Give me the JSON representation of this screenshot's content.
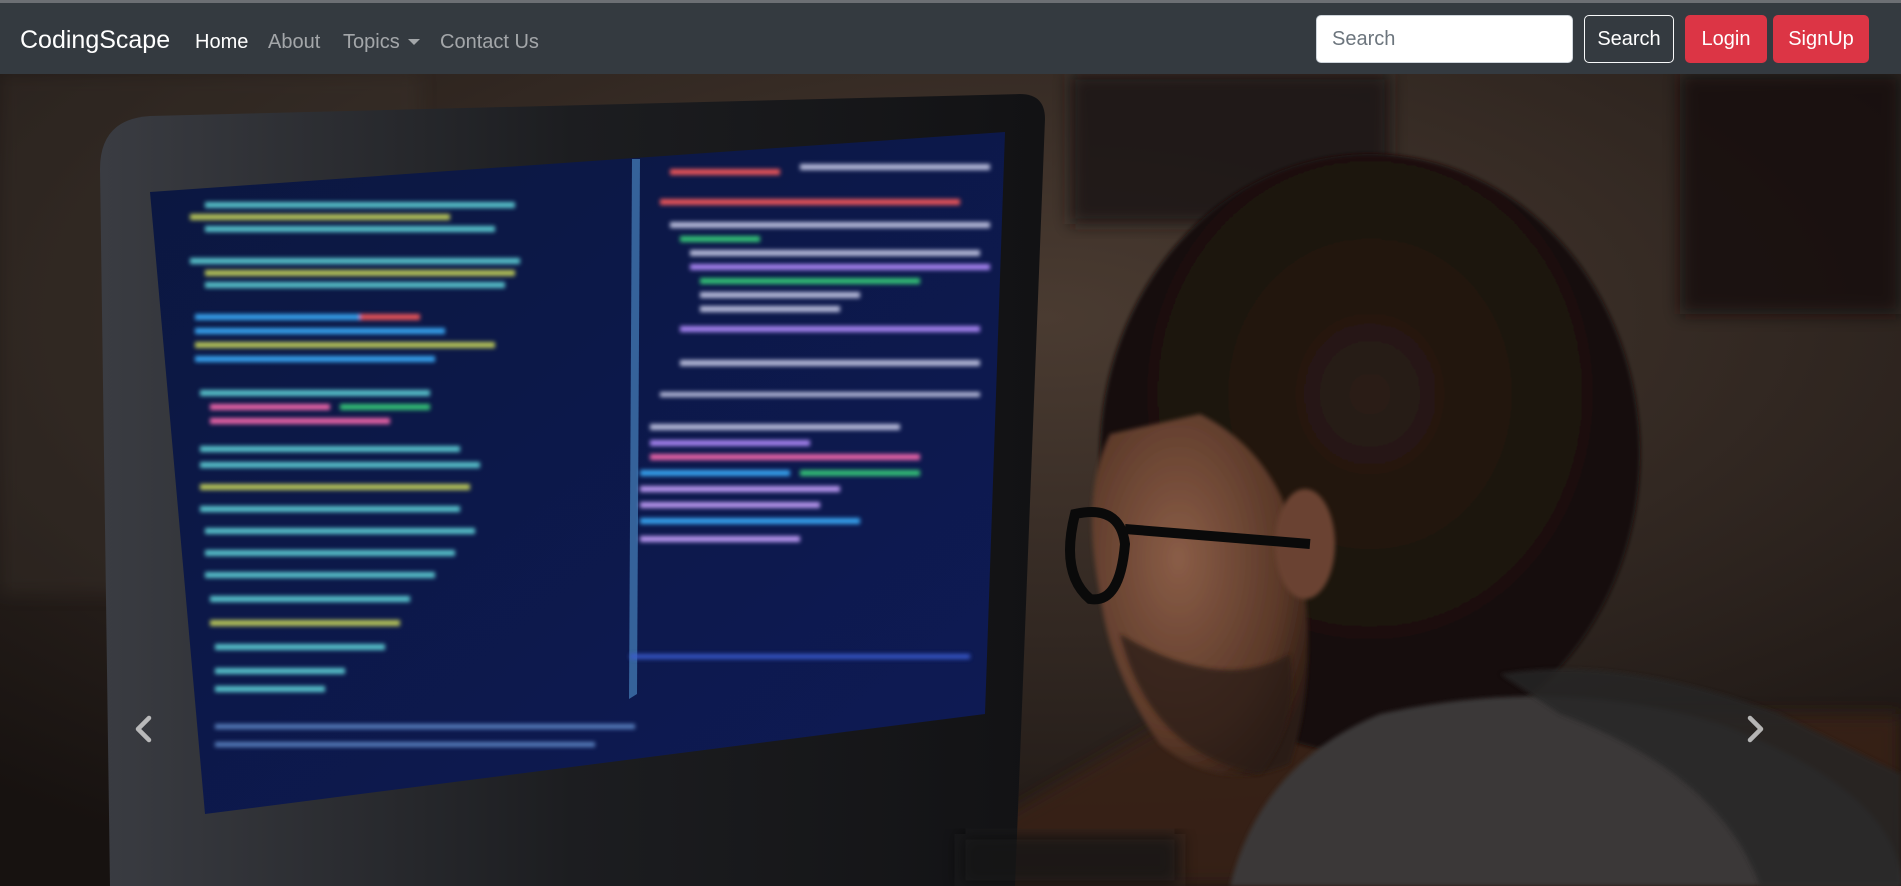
{
  "navbar": {
    "brand": "CodingScape",
    "links": [
      {
        "label": "Home",
        "active": true
      },
      {
        "label": "About",
        "active": false
      },
      {
        "label": "Topics",
        "active": false,
        "dropdown": true
      },
      {
        "label": "Contact Us",
        "active": false
      }
    ],
    "search": {
      "placeholder": "Search",
      "value": ""
    },
    "search_button": "Search",
    "login_button": "Login",
    "signup_button": "SignUp"
  },
  "carousel": {
    "prev_icon": "chevron-left-icon",
    "next_icon": "chevron-right-icon"
  },
  "colors": {
    "navbar_bg": "#343a40",
    "danger": "#dc3545",
    "brand_text": "#ffffff"
  }
}
